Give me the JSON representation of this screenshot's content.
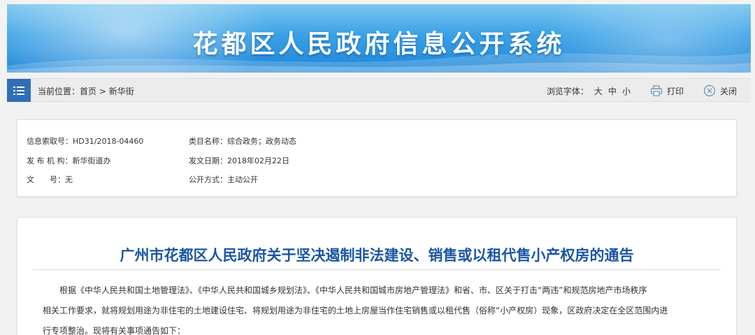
{
  "header": {
    "title": "花都区人民政府信息公开系统",
    "colors": {
      "banner_top": "#7cc7f0",
      "banner_bottom": "#1e86d8"
    }
  },
  "nav": {
    "icon": "list-menu-icon",
    "crumb_prefix": "当前位置：",
    "crumb_home": "首页",
    "crumb_sep": " > ",
    "crumb_current": "新华街",
    "font_label": "浏览字体：",
    "font_large": "大",
    "font_medium": "中",
    "font_small": "小",
    "print_label": "打印",
    "close_label": "关闭",
    "accent": "#2f6fb8"
  },
  "meta": {
    "index_label": "信息索取号：",
    "index_value": "HD31/2018-04460",
    "category_label": "类目名称：",
    "category_value": "综合政务；政务动态",
    "publisher_label": "发 布 机 构：",
    "publisher_value": "新华街道办",
    "date_label": "发文日期：",
    "date_value": "2018年02月22日",
    "doc_label": "文　　号：",
    "doc_value": "无",
    "mode_label": "公开方式：",
    "mode_value": "主动公开"
  },
  "article": {
    "title": "广州市花都区人民政府关于坚决遏制非法建设、销售或以租代售小产权房的通告",
    "title_color": "#1c56a3",
    "lines": [
      "根据《中华人民共和国土地管理法》、《中华人民共和国城乡规划法》、《中华人民共和国城市房地产管理法》和省、市、区关于打击“两违”和规范房地产市场秩序",
      "相关工作要求，就将规划用途为非住宅的土地建设住宅、将规划用途为非住宅的土地上房屋当作住宅销售或以租代售（俗称“小产权房）现象，区政府决定在全区范围内进",
      "行专项整治。现将有关事项通告如下："
    ]
  }
}
